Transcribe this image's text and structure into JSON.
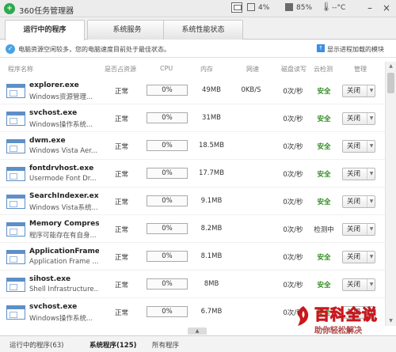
{
  "app": {
    "title": "360任务管理器",
    "logo_icon": "360-logo-icon",
    "tray": {
      "cpu_percent": "4%",
      "memory_percent": "85%",
      "temperature": "--°C"
    }
  },
  "tabs": [
    {
      "label": "运行中的程序",
      "active": true
    },
    {
      "label": "系统服务",
      "active": false
    },
    {
      "label": "系统性能状态",
      "active": false
    }
  ],
  "info": {
    "message": "电脑资源空闲较多，您的电脑速度目前处于最佳状态。",
    "toggle_label": "显示进程加载的模块"
  },
  "columns": {
    "name": "程序名称",
    "resource": "是否占资源",
    "cpu": "CPU",
    "memory": "内存",
    "network": "网速",
    "disk": "磁盘读写",
    "cloud": "云检测",
    "manage": "管理"
  },
  "rows": [
    {
      "name": "explorer.exe",
      "desc": "Windows资源管理...",
      "resource": "正常",
      "cpu": "0%",
      "memory": "49MB",
      "network": "0KB/S",
      "disk": "0次/秒",
      "cloud": "安全",
      "action": "关闭"
    },
    {
      "name": "svchost.exe",
      "desc": "Windows操作系统...",
      "resource": "正常",
      "cpu": "0%",
      "memory": "31MB",
      "network": "",
      "disk": "0次/秒",
      "cloud": "安全",
      "action": "关闭"
    },
    {
      "name": "dwm.exe",
      "desc": "Windows Vista Aer...",
      "resource": "正常",
      "cpu": "0%",
      "memory": "18.5MB",
      "network": "",
      "disk": "0次/秒",
      "cloud": "安全",
      "action": "关闭"
    },
    {
      "name": "fontdrvhost.exe",
      "desc": "Usermode Font Dr...",
      "resource": "正常",
      "cpu": "0%",
      "memory": "17.7MB",
      "network": "",
      "disk": "0次/秒",
      "cloud": "安全",
      "action": "关闭"
    },
    {
      "name": "SearchIndexer.exe",
      "desc": "Windows Vista系统...",
      "resource": "正常",
      "cpu": "0%",
      "memory": "9.1MB",
      "network": "",
      "disk": "0次/秒",
      "cloud": "安全",
      "action": "关闭"
    },
    {
      "name": "Memory Compres...",
      "desc": "程序可能存在有自身...",
      "resource": "正常",
      "cpu": "0%",
      "memory": "8.2MB",
      "network": "",
      "disk": "0次/秒",
      "cloud": "检测中",
      "action": "关闭"
    },
    {
      "name": "ApplicationFrame...",
      "desc": "Application Frame ...",
      "resource": "正常",
      "cpu": "0%",
      "memory": "8.1MB",
      "network": "",
      "disk": "0次/秒",
      "cloud": "安全",
      "action": "关闭"
    },
    {
      "name": "sihost.exe",
      "desc": "Shell Infrastructure...",
      "resource": "正常",
      "cpu": "0%",
      "memory": "8MB",
      "network": "",
      "disk": "0次/秒",
      "cloud": "安全",
      "action": "关闭"
    },
    {
      "name": "svchost.exe",
      "desc": "Windows操作系统...",
      "resource": "正常",
      "cpu": "0%",
      "memory": "6.7MB",
      "network": "",
      "disk": "0次/秒",
      "cloud": "安全",
      "action": "关闭"
    }
  ],
  "status": {
    "running": "运行中的程序(63)",
    "system": "系统程序(125)",
    "all": "所有程序"
  },
  "colors": {
    "safe": "#2e8b1e",
    "accent": "#3a8ee6",
    "watermark": "#c9171d"
  },
  "watermark": {
    "title": "百科全说",
    "subtitle": "助你轻松解决"
  }
}
